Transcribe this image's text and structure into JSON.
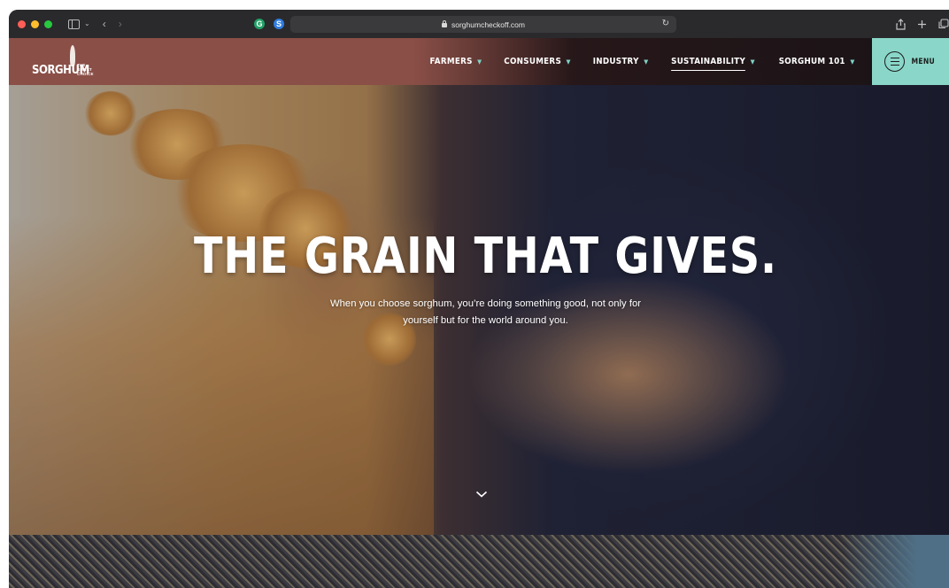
{
  "browser": {
    "url": "sorghumcheckoff.com",
    "extensions": [
      "G",
      "S"
    ]
  },
  "site": {
    "logo_word": "SORGHUM",
    "logo_tagline": "THE SMART CHOICE"
  },
  "nav": {
    "items": [
      {
        "label": "FARMERS",
        "active": false
      },
      {
        "label": "CONSUMERS",
        "active": false
      },
      {
        "label": "INDUSTRY",
        "active": false
      },
      {
        "label": "SUSTAINABILITY",
        "active": true
      },
      {
        "label": "SORGHUM 101",
        "active": false
      }
    ],
    "menu_label": "MENU"
  },
  "hero": {
    "title": "THE GRAIN THAT GIVES.",
    "subtitle": "When you choose sorghum, you’re doing something good, not only for yourself but for the world around you."
  },
  "colors": {
    "nav_brand": "#8a4f47",
    "menu_button": "#8ad7c9",
    "caret_accent": "#7fd3c6"
  },
  "icons": {
    "nav_caret": "caret-down-icon",
    "menu": "hamburger-menu-icon",
    "scroll": "chevron-down-icon"
  }
}
